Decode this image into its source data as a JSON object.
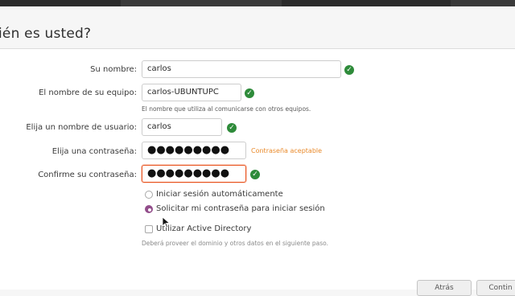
{
  "header": {
    "title": "ién es usted?"
  },
  "form": {
    "name": {
      "label": "Su nombre:",
      "value": "carlos"
    },
    "computer": {
      "label": "El nombre de su equipo:",
      "value": "carlos-UBUNTUPC",
      "hint": "El nombre que utiliza al comunicarse con otros equipos."
    },
    "username": {
      "label": "Elija un nombre de usuario:",
      "value": "carlos"
    },
    "password": {
      "label": "Elija una contraseña:",
      "mask": "●●●●●●●●●",
      "strength": "Contraseña aceptable"
    },
    "confirm": {
      "label": "Confirme su contraseña:",
      "mask": "●●●●●●●●●"
    }
  },
  "login_options": [
    {
      "label": "Iniciar sesión automáticamente",
      "selected": false
    },
    {
      "label": "Solicitar mi contraseña para iniciar sesión",
      "selected": true
    }
  ],
  "active_directory": {
    "label": "Utilizar Active Directory",
    "checked": false,
    "hint": "Deberá proveer el dominio y otros datos en el siguiente paso."
  },
  "buttons": {
    "back": "Atrás",
    "continue": "Contin"
  },
  "colors": {
    "accent": "#e95420",
    "success": "#2e8b3a",
    "radio": "#924d8b",
    "warning": "#e98a2b"
  },
  "icons": {
    "valid": "check-circle-icon",
    "pointer": "mouse-pointer-icon"
  }
}
